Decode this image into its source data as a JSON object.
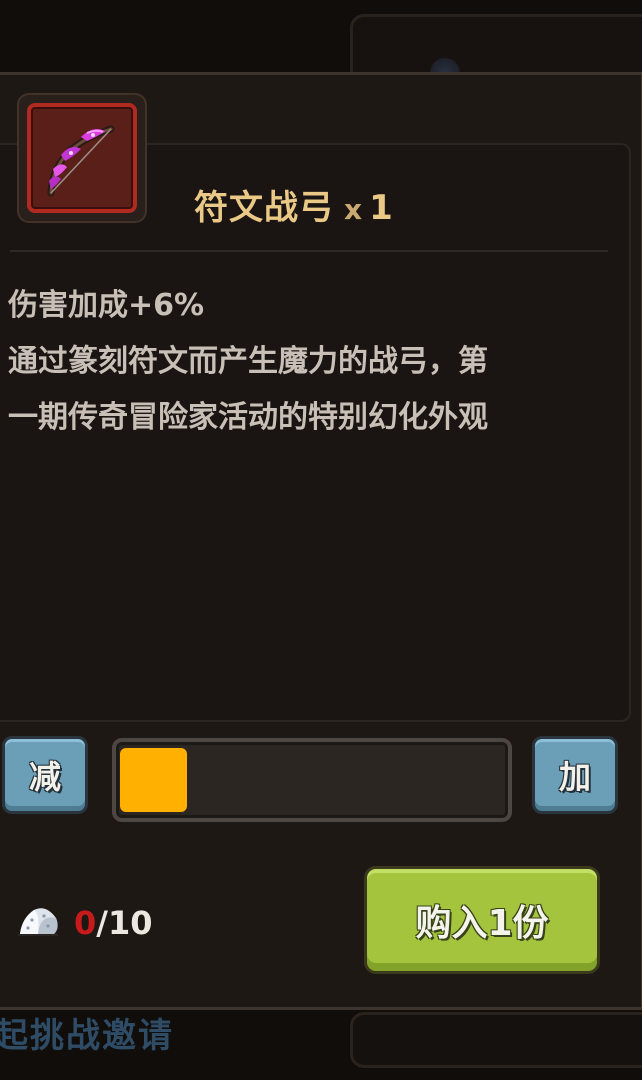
{
  "background": {
    "bottom_text": "起挑战邀请"
  },
  "item": {
    "name": "符文战弓",
    "qty_prefix": "x",
    "qty": "1",
    "icon": "rune-bow-icon",
    "rarity_color": "#b02a22"
  },
  "description": {
    "line1": "伤害加成+6%",
    "line2": "通过篆刻符文而产生魔力的战弓，第",
    "line3": "一期传奇冒险家活动的特别幻化外观"
  },
  "quantity": {
    "minus_label": "减",
    "plus_label": "加",
    "slider_fraction": 0.1
  },
  "price": {
    "currency_icon": "diamond-ore-icon",
    "owned": "0",
    "separator": "/",
    "cost": "10"
  },
  "buy_button": {
    "label": "购入1份"
  },
  "colors": {
    "accent_gold": "#eac886",
    "buy_green": "#a3c43c",
    "slider_fill": "#ffb000",
    "button_blue": "#6b9fb8",
    "insufficient_red": "#c71a1a"
  }
}
